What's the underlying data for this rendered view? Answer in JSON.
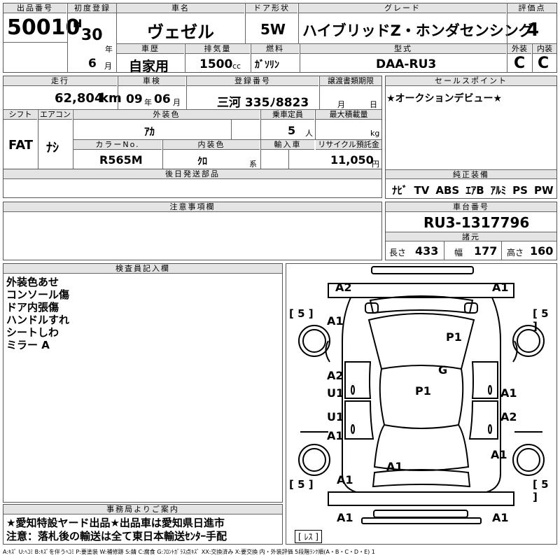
{
  "header_row1": {
    "lot_label": "出品番号",
    "lot_value": "50010",
    "first_reg_label": "初度登録",
    "era": "H",
    "year": "30",
    "year_unit": "年",
    "car_name_label": "車名",
    "car_name": "ヴェゼル",
    "door_label": "ドア形状",
    "door": "5W",
    "grade_label": "グレード",
    "grade": "ハイブリッドZ・ホンダセンシング",
    "score_label": "評価点",
    "score": "4"
  },
  "header_row2": {
    "month": "6",
    "month_unit": "月",
    "history_label": "車歴",
    "history": "自家用",
    "displacement_label": "排気量",
    "displacement": "1500",
    "displacement_unit": "cc",
    "fuel_label": "燃料",
    "fuel": "ｶﾞｿﾘﾝ",
    "model_label": "型式",
    "model": "DAA-RU3",
    "exterior_label": "外装",
    "exterior": "C",
    "interior_label": "内装",
    "interior": "C"
  },
  "row3": {
    "mileage_label": "走行",
    "mileage": "62,804",
    "mileage_unit": "km",
    "inspection_label": "車検",
    "insp_year": "09",
    "insp_year_unit": "年",
    "insp_month": "06",
    "insp_month_unit": "月",
    "plate_label": "登録番号",
    "plate": "三河 335ﾉ8823",
    "transfer_label": "譲渡書類期限",
    "transfer_month_unit": "月",
    "transfer_day_unit": "日",
    "sales_label": "セールスポイント",
    "sales_text": "★オークションデビュー★"
  },
  "row4": {
    "shift_label": "シフト",
    "shift": "FAT",
    "ac_label": "エアコン",
    "ac": "ﾅｼ",
    "ext_color_label": "外装色",
    "ext_color": "ｱｶ",
    "capacity_label": "乗車定員",
    "capacity": "5",
    "capacity_unit": "人",
    "load_label": "最大積載量",
    "load_unit": "kg",
    "color_no_label": "カラーNo.",
    "color_no": "R565M",
    "int_color_label": "内装色",
    "int_color": "ｸﾛ",
    "int_color_unit": "系",
    "import_label": "輸入車",
    "recycle_label": "リサイクル預託金",
    "recycle": "11,050",
    "recycle_unit": "円"
  },
  "later_parts_label": "後日発送部品",
  "equipment_label": "純正装備",
  "equipment": [
    "ﾅﾋﾞ",
    "TV",
    "ABS",
    "ｴｱB",
    "ｱﾙﾐ",
    "PS",
    "PW"
  ],
  "caution_label": "注意事項欄",
  "chassis_label": "車台番号",
  "chassis": "RU3-1317796",
  "specs_label": "諸元",
  "length_label": "長さ",
  "length": "433",
  "width_label": "幅",
  "width": "177",
  "height_label": "高さ",
  "height": "160",
  "inspector_label": "検査員記入欄",
  "inspector_notes": [
    "外装色あせ",
    "コンソール傷",
    "ドア内張傷",
    "ハンドルすれ",
    "シートしわ",
    "ミラー A"
  ],
  "office_label": "事務局よりご案内",
  "office_notes": [
    "★愛知特設ヤード出品★出品車は愛知県日進市",
    "注意：落札後の輸送は全て東日本輸送ｾﾝﾀｰ手配"
  ],
  "legend": "A:ｷｽﾞ U:ﾍｺﾐ B:ｷｽﾞを伴うﾍｺﾐ P:要塗装 W:補修跡 S:錆 C:腐食 G:ﾌﾛﾝﾄｶﾞﾗｽ点ｷｽﾞ XX:交換済み X:要交換 内・外装評価 5段階ﾗﾝｸ順(A・B・C・D・E) 1",
  "diagram": {
    "tire_fl": "[ 5 ]",
    "tire_fr": "[ 5 ]",
    "tire_rl": "[ 5 ]",
    "tire_rr": "[ 5 ]",
    "spare": "[ ﾚｽ ]",
    "marks": [
      "A2",
      "A1",
      "A1",
      "P1",
      "G",
      "A2",
      "U1",
      "P1",
      "A1",
      "U1",
      "A2",
      "A1",
      "A1",
      "A1",
      "A1",
      "A1",
      "A1"
    ]
  }
}
